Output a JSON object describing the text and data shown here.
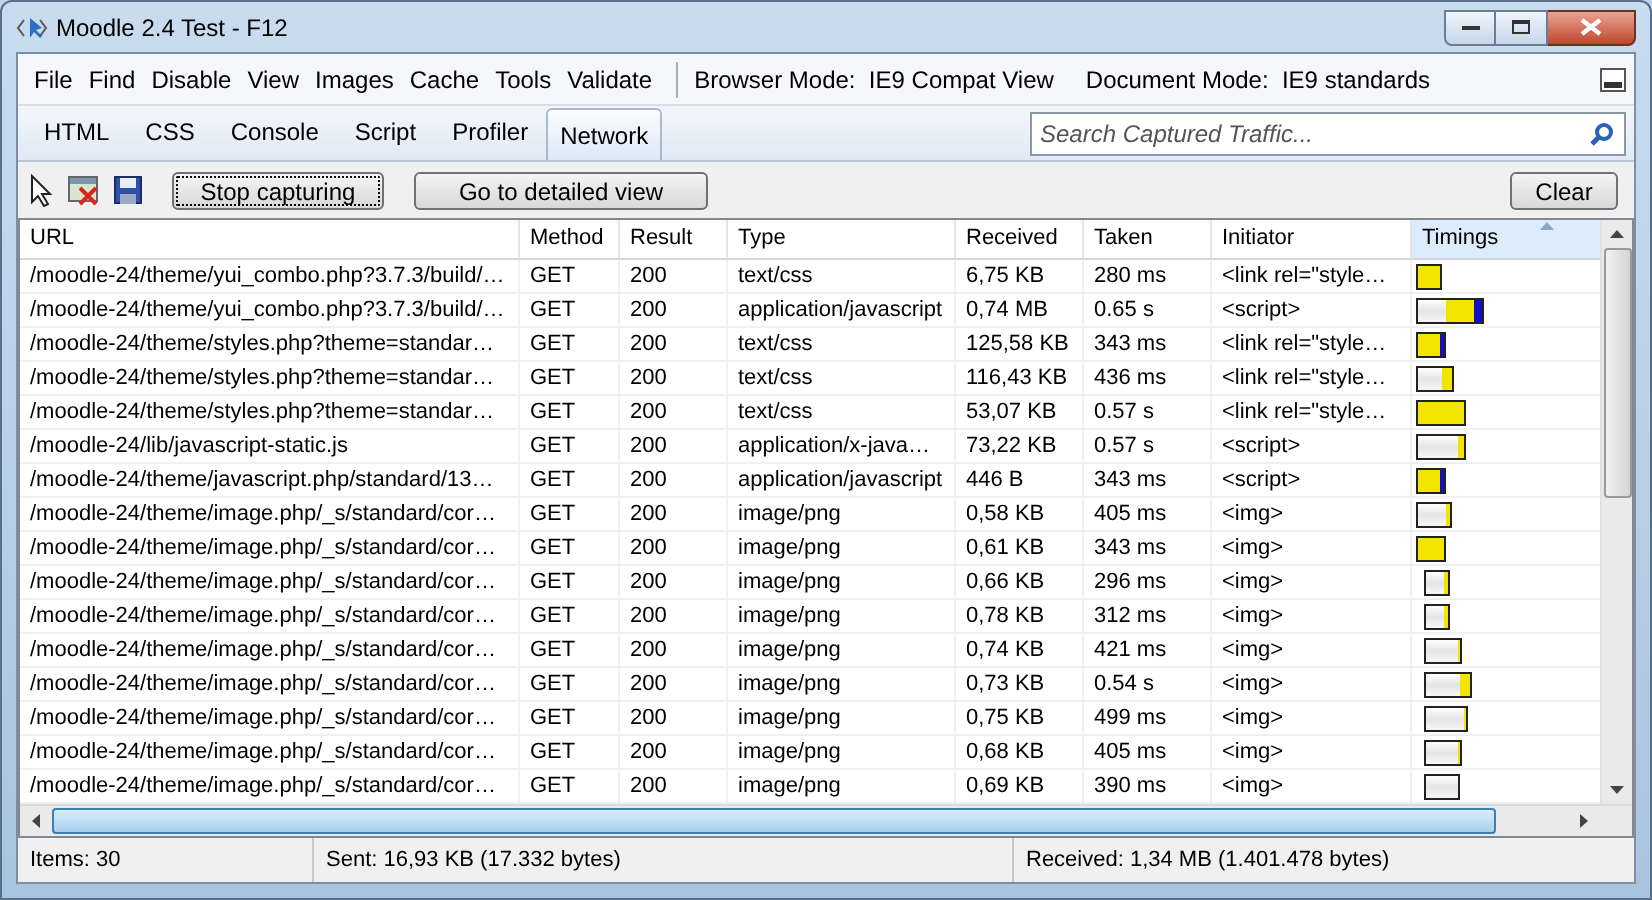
{
  "window": {
    "title": "Moodle 2.4 Test - F12"
  },
  "menu": [
    "File",
    "Find",
    "Disable",
    "View",
    "Images",
    "Cache",
    "Tools",
    "Validate"
  ],
  "modes": [
    "Browser Mode:  IE9 Compat View",
    "Document Mode:  IE9 standards"
  ],
  "tabs": [
    {
      "label": "HTML",
      "selected": false
    },
    {
      "label": "CSS",
      "selected": false
    },
    {
      "label": "Console",
      "selected": false
    },
    {
      "label": "Script",
      "selected": false
    },
    {
      "label": "Profiler",
      "selected": false
    },
    {
      "label": "Network",
      "selected": true
    }
  ],
  "search": {
    "placeholder": "Search Captured Traffic..."
  },
  "toolbar": {
    "capture_button": "Stop capturing",
    "detail_button": "Go to detailed view",
    "clear_button": "Clear"
  },
  "table": {
    "columns": [
      {
        "label": "URL",
        "sorted": false
      },
      {
        "label": "Method",
        "sorted": false
      },
      {
        "label": "Result",
        "sorted": false
      },
      {
        "label": "Type",
        "sorted": false
      },
      {
        "label": "Received",
        "sorted": false
      },
      {
        "label": "Taken",
        "sorted": false
      },
      {
        "label": "Initiator",
        "sorted": false
      },
      {
        "label": "Timings",
        "sorted": true
      }
    ],
    "rows": [
      [
        "/moodle-24/theme/yui_combo.php?3.7.3/build/…",
        "GET",
        "200",
        "text/css",
        "6,75 KB",
        "280 ms",
        "<link rel=\"style…"
      ],
      [
        "/moodle-24/theme/yui_combo.php?3.7.3/build/…",
        "GET",
        "200",
        "application/javascript",
        "0,74 MB",
        "0.65 s",
        "<script>"
      ],
      [
        "/moodle-24/theme/styles.php?theme=standar…",
        "GET",
        "200",
        "text/css",
        "125,58 KB",
        "343 ms",
        "<link rel=\"style…"
      ],
      [
        "/moodle-24/theme/styles.php?theme=standar…",
        "GET",
        "200",
        "text/css",
        "116,43 KB",
        "436 ms",
        "<link rel=\"style…"
      ],
      [
        "/moodle-24/theme/styles.php?theme=standar…",
        "GET",
        "200",
        "text/css",
        "53,07 KB",
        "0.57 s",
        "<link rel=\"style…"
      ],
      [
        "/moodle-24/lib/javascript-static.js",
        "GET",
        "200",
        "application/x-java…",
        "73,22 KB",
        "0.57 s",
        "<script>"
      ],
      [
        "/moodle-24/theme/javascript.php/standard/13…",
        "GET",
        "200",
        "application/javascript",
        "446 B",
        "343 ms",
        "<script>"
      ],
      [
        "/moodle-24/theme/image.php/_s/standard/cor…",
        "GET",
        "200",
        "image/png",
        "0,58 KB",
        "405 ms",
        "<img>"
      ],
      [
        "/moodle-24/theme/image.php/_s/standard/cor…",
        "GET",
        "200",
        "image/png",
        "0,61 KB",
        "343 ms",
        "<img>"
      ],
      [
        "/moodle-24/theme/image.php/_s/standard/cor…",
        "GET",
        "200",
        "image/png",
        "0,66 KB",
        "296 ms",
        "<img>"
      ],
      [
        "/moodle-24/theme/image.php/_s/standard/cor…",
        "GET",
        "200",
        "image/png",
        "0,78 KB",
        "312 ms",
        "<img>"
      ],
      [
        "/moodle-24/theme/image.php/_s/standard/cor…",
        "GET",
        "200",
        "image/png",
        "0,74 KB",
        "421 ms",
        "<img>"
      ],
      [
        "/moodle-24/theme/image.php/_s/standard/cor…",
        "GET",
        "200",
        "image/png",
        "0,73 KB",
        "0.54 s",
        "<img>"
      ],
      [
        "/moodle-24/theme/image.php/_s/standard/cor…",
        "GET",
        "200",
        "image/png",
        "0,75 KB",
        "499 ms",
        "<img>"
      ],
      [
        "/moodle-24/theme/image.php/_s/standard/cor…",
        "GET",
        "200",
        "image/png",
        "0,68 KB",
        "405 ms",
        "<img>"
      ],
      [
        "/moodle-24/theme/image.php/_s/standard/cor…",
        "GET",
        "200",
        "image/png",
        "0,69 KB",
        "390 ms",
        "<img>"
      ]
    ]
  },
  "status_bar": [
    "Items: 30",
    "Sent: 16,93 KB (17.332 bytes)",
    "Received: 1,34 MB (1.401.478 bytes)"
  ]
}
